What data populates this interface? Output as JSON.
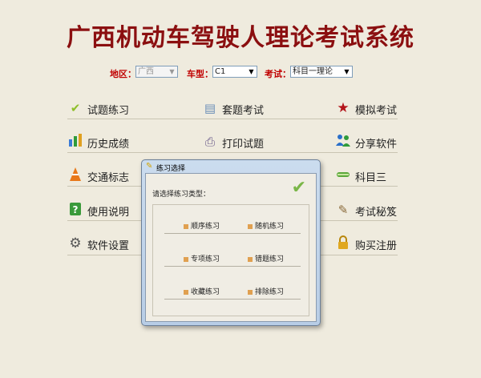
{
  "app": {
    "title": "广西机动车驾驶人理论考试系统"
  },
  "filters": {
    "region": {
      "label": "地区：",
      "value": "广西"
    },
    "vehicle": {
      "label": "车型：",
      "value": "C1"
    },
    "exam": {
      "label": "考试：",
      "value": "科目一理论"
    }
  },
  "menu": {
    "items": [
      {
        "label": "试题练习",
        "icon": "check-icon"
      },
      {
        "label": "套题考试",
        "icon": "document-icon"
      },
      {
        "label": "模拟考试",
        "icon": "star-icon"
      },
      {
        "label": "历史成绩",
        "icon": "bar-chart-icon"
      },
      {
        "label": "打印试题",
        "icon": "printer-icon"
      },
      {
        "label": "分享软件",
        "icon": "users-icon"
      },
      {
        "label": "交通标志",
        "icon": "traffic-cone-icon"
      },
      {
        "label": "科目三",
        "icon": "car-icon"
      },
      {
        "label": "使用说明",
        "icon": "help-icon"
      },
      {
        "label": "考试秘笈",
        "icon": "scroll-icon"
      },
      {
        "label": "软件设置",
        "icon": "gear-icon"
      },
      {
        "label": "购买注册",
        "icon": "lock-icon"
      }
    ]
  },
  "dialog": {
    "title": "练习选择",
    "prompt": "请选择练习类型：",
    "options": [
      "顺序练习",
      "随机练习",
      "专项练习",
      "错题练习",
      "收藏练习",
      "排除练习"
    ]
  }
}
